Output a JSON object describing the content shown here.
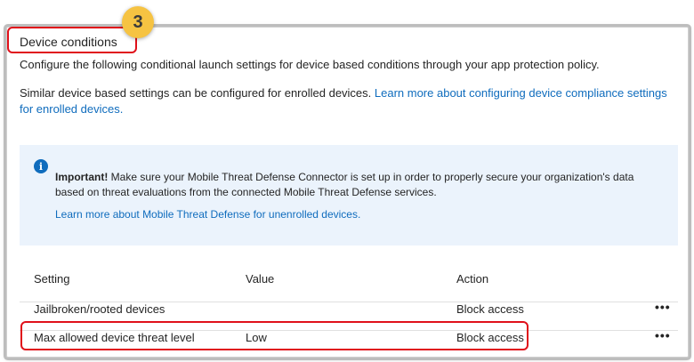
{
  "step_badge": "3",
  "section": {
    "title": "Device conditions",
    "description": "Configure the following conditional launch settings for device based conditions through your app protection policy.",
    "enrolled_text": "Similar device based settings can be configured for enrolled devices. ",
    "enrolled_link": "Learn more about configuring device compliance settings for enrolled devices."
  },
  "info": {
    "icon": "info-icon",
    "bold": "Important!",
    "text": " Make sure your Mobile Threat Defense Connector is set up in order to properly secure your organization's data based on threat evaluations from the connected Mobile Threat Defense services.",
    "link": "Learn more about Mobile Threat Defense for unenrolled devices."
  },
  "table": {
    "headers": [
      "Setting",
      "Value",
      "Action"
    ],
    "rows": [
      {
        "setting": "Jailbroken/rooted devices",
        "value": "",
        "action": "Block access",
        "more": "•••"
      },
      {
        "setting": "Max allowed device threat level",
        "value": "Low",
        "action": "Block access",
        "more": "•••"
      }
    ]
  },
  "colors": {
    "accent": "#0f6cbd",
    "highlight": "#e0101a",
    "badge": "#f6c342",
    "info_bg": "#ebf3fc"
  }
}
